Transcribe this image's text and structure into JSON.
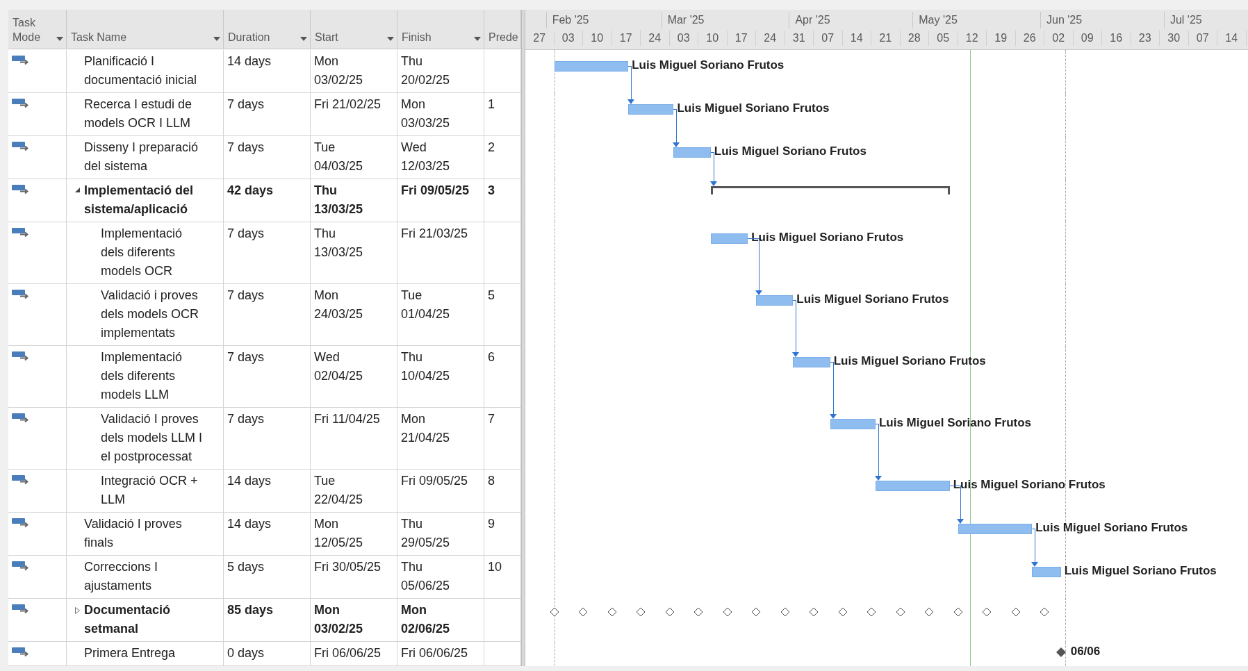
{
  "columns": [
    {
      "label": "Task\nMode",
      "menu": true
    },
    {
      "label": "Task Name",
      "menu": true
    },
    {
      "label": "Duration",
      "menu": true
    },
    {
      "label": "Start",
      "menu": true
    },
    {
      "label": "Finish",
      "menu": true
    },
    {
      "label": "Prede",
      "menu": false
    }
  ],
  "timescale": {
    "months": [
      "Feb '25",
      "Mar '25",
      "Apr '25",
      "May '25",
      "Jun '25",
      "Jul '25"
    ],
    "weeks": [
      "27",
      "03",
      "10",
      "17",
      "24",
      "03",
      "10",
      "17",
      "24",
      "31",
      "07",
      "14",
      "21",
      "28",
      "05",
      "12",
      "19",
      "26",
      "02",
      "09",
      "16",
      "23",
      "30",
      "07",
      "14"
    ]
  },
  "tasks": [
    {
      "kind": "task",
      "name": "Planificació I\ndocumentació inicial",
      "duration": "14 days",
      "start": "Mon\n03/02/25",
      "finish": "Thu\n20/02/25",
      "resource": "Luis Miguel Soriano Frutos"
    },
    {
      "kind": "task",
      "name": "Recerca I estudi de\nmodels OCR I LLM",
      "duration": "7 days",
      "start": "Fri 21/02/25",
      "finish": "Mon\n03/03/25",
      "predecessors": "1",
      "resource": "Luis Miguel Soriano Frutos"
    },
    {
      "kind": "task",
      "name": "Disseny I preparació\ndel sistema",
      "duration": "7 days",
      "start": "Tue\n04/03/25",
      "finish": "Wed\n12/03/25",
      "predecessors": "2",
      "resource": "Luis Miguel Soriano Frutos"
    },
    {
      "kind": "summary",
      "expanded": true,
      "name": "Implementació del\nsistema/aplicació",
      "duration": "42 days",
      "start": "Thu\n13/03/25",
      "finish": "Fri 09/05/25",
      "predecessors": "3",
      "children": [
        {
          "kind": "task",
          "name": "Implementació\ndels diferents\nmodels OCR",
          "duration": "7 days",
          "start": "Thu\n13/03/25",
          "finish": "Fri 21/03/25",
          "resource": "Luis Miguel Soriano Frutos"
        },
        {
          "kind": "task",
          "name": "Validació i proves\ndels models OCR\nimplementats",
          "duration": "7 days",
          "start": "Mon\n24/03/25",
          "finish": "Tue\n01/04/25",
          "predecessors": "5",
          "resource": "Luis Miguel Soriano Frutos"
        },
        {
          "kind": "task",
          "name": "Implementació\ndels diferents\nmodels LLM",
          "duration": "7 days",
          "start": "Wed\n02/04/25",
          "finish": "Thu\n10/04/25",
          "predecessors": "6",
          "resource": "Luis Miguel Soriano Frutos"
        },
        {
          "kind": "task",
          "name": "Validació I proves\ndels models LLM I\nel postprocessat",
          "duration": "7 days",
          "start": "Fri 11/04/25",
          "finish": "Mon\n21/04/25",
          "predecessors": "7",
          "resource": "Luis Miguel Soriano Frutos"
        },
        {
          "kind": "task",
          "name": "Integració OCR +\nLLM",
          "duration": "14 days",
          "start": "Tue\n22/04/25",
          "finish": "Fri 09/05/25",
          "predecessors": "8",
          "resource": "Luis Miguel Soriano Frutos"
        }
      ]
    },
    {
      "kind": "task",
      "name": "Validació I proves\nfinals",
      "duration": "14 days",
      "start": "Mon\n12/05/25",
      "finish": "Thu\n29/05/25",
      "predecessors": "9",
      "resource": "Luis Miguel Soriano Frutos"
    },
    {
      "kind": "task",
      "name": "Correccions I\najustaments",
      "duration": "5 days",
      "start": "Fri 30/05/25",
      "finish": "Thu\n05/06/25",
      "predecessors": "10",
      "resource": "Luis Miguel Soriano Frutos"
    },
    {
      "kind": "recurring",
      "expanded": false,
      "name": "Documentació\nsetmanal",
      "duration": "85 days",
      "start": "Mon\n03/02/25",
      "finish": "Mon\n02/06/25"
    },
    {
      "kind": "milestone",
      "name": "Primera Entrega",
      "duration": "0 days",
      "start": "Fri 06/06/25",
      "finish": "Fri 06/06/25",
      "label": "06/06"
    }
  ]
}
